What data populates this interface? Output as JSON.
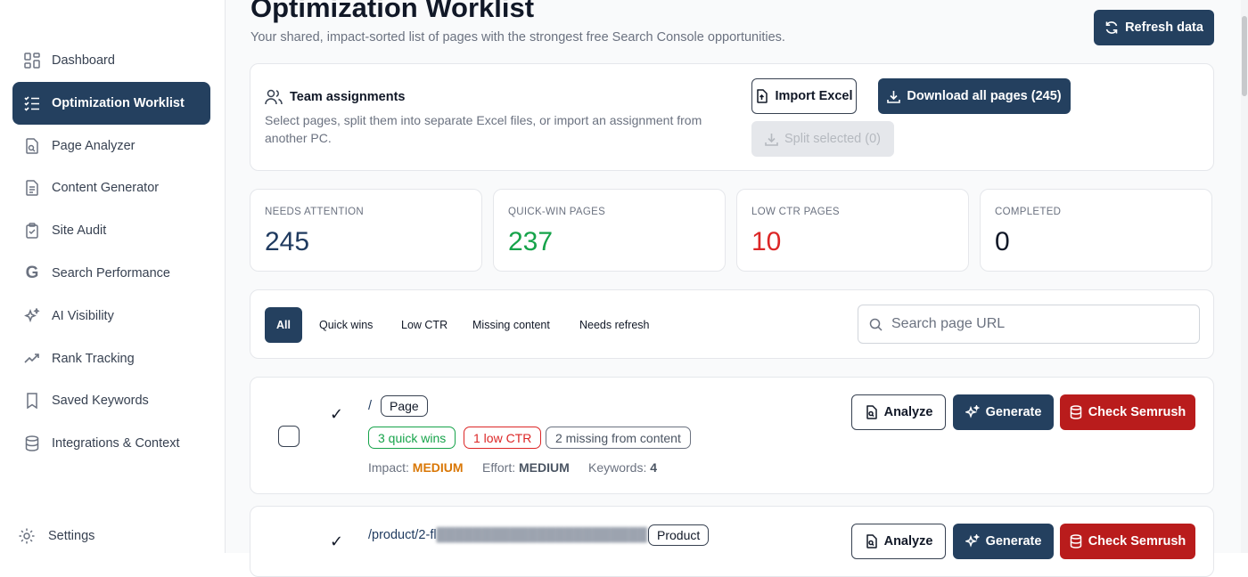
{
  "sidebar": {
    "items": [
      {
        "label": "Dashboard",
        "icon": "grid-icon"
      },
      {
        "label": "Optimization Worklist",
        "icon": "list-check-icon"
      },
      {
        "label": "Page Analyzer",
        "icon": "file-search-icon"
      },
      {
        "label": "Content Generator",
        "icon": "document-icon"
      },
      {
        "label": "Site Audit",
        "icon": "clipboard-check-icon"
      },
      {
        "label": "Search Performance",
        "icon": "google-icon"
      },
      {
        "label": "AI Visibility",
        "icon": "sparkles-icon"
      },
      {
        "label": "Rank Tracking",
        "icon": "trending-up-icon"
      },
      {
        "label": "Saved Keywords",
        "icon": "bookmark-icon"
      },
      {
        "label": "Integrations & Context",
        "icon": "database-icon"
      }
    ],
    "active_index": 1,
    "settings_label": "Settings"
  },
  "header": {
    "title": "Optimization Worklist",
    "subtitle": "Your shared, impact-sorted list of pages with the strongest free Search Console opportunities.",
    "refresh_label": "Refresh data"
  },
  "team": {
    "title": "Team assignments",
    "description": "Select pages, split them into separate Excel files, or import an assignment from another PC.",
    "import_label": "Import Excel",
    "download_label": "Download all pages (245)",
    "split_label": "Split selected (0)"
  },
  "stats": [
    {
      "label": "NEEDS ATTENTION",
      "value": "245",
      "color": "#1f3a5f"
    },
    {
      "label": "QUICK-WIN PAGES",
      "value": "237",
      "color": "#16a34a"
    },
    {
      "label": "LOW CTR PAGES",
      "value": "10",
      "color": "#dc2626"
    },
    {
      "label": "COMPLETED",
      "value": "0",
      "color": "#111827"
    }
  ],
  "filters": {
    "chips": [
      "All",
      "Quick wins",
      "Low CTR",
      "Missing content",
      "Needs refresh"
    ],
    "active_index": 0,
    "search_placeholder": "Search page URL"
  },
  "rows": [
    {
      "url": "/",
      "type": "Page",
      "badges": {
        "quick_wins": "3 quick wins",
        "low_ctr": "1 low CTR",
        "missing": "2 missing from content"
      },
      "impact_label": "Impact:",
      "impact": "MEDIUM",
      "effort_label": "Effort:",
      "effort": "MEDIUM",
      "keywords_label": "Keywords:",
      "keywords": "4"
    },
    {
      "url": "/product/2-fl",
      "type": "Product"
    }
  ],
  "actions": {
    "analyze": "Analyze",
    "generate": "Generate",
    "semrush": "Check Semrush"
  },
  "colors": {
    "accent": "#24405f",
    "danger": "#b91c1c",
    "success": "#16a34a",
    "warning": "#d97706"
  }
}
